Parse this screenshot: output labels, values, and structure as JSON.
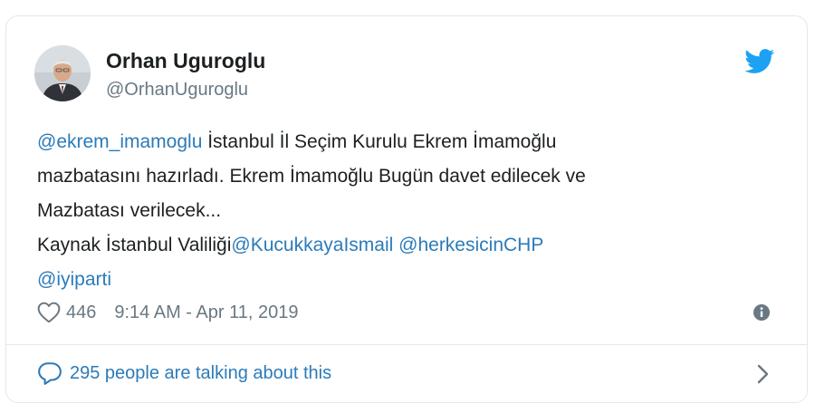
{
  "author": {
    "name": "Orhan Uguroglu",
    "handle": "@OrhanUguroglu"
  },
  "tweet": {
    "mention1": "@ekrem_imamoglu",
    "line1_rest": " İstanbul İl Seçim Kurulu Ekrem İmamoğlu",
    "line2": "mazbatasını hazırladı. Ekrem İmamoğlu Bugün davet edilecek ve",
    "line3": "Mazbatası verilecek...",
    "line4_prefix": "Kaynak İstanbul Valiliği",
    "mention2": "@KucukkayaIsmail",
    "space": " ",
    "mention3": "@herkesicinCHP",
    "mention4": "@iyiparti"
  },
  "meta": {
    "likes": "446",
    "timestamp": "9:14 AM - Apr 11, 2019"
  },
  "footer": {
    "talking": "295 people are talking about this"
  },
  "icons": {
    "brand": "twitter-bird-icon",
    "like": "heart-icon",
    "info": "info-icon",
    "reply": "speech-bubble-icon",
    "more": "chevron-right-icon"
  },
  "colors": {
    "link": "#2b7bb9",
    "twitter_blue": "#1da1f2",
    "muted": "#697882",
    "text": "#1c2022",
    "border": "#e1e8ed"
  }
}
